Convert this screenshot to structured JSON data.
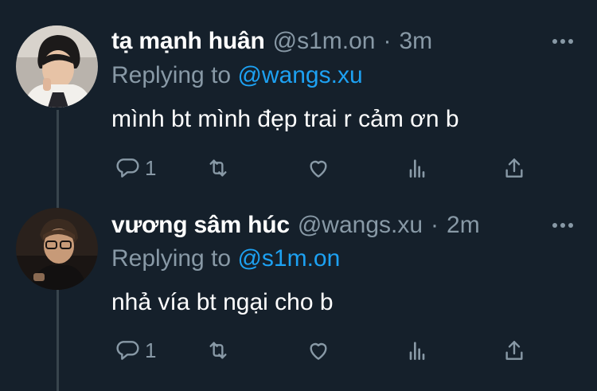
{
  "tweets": [
    {
      "name": "tạ mạnh huân",
      "handle": "@s1m.on",
      "separator": "·",
      "time": "3m",
      "replying_prefix": "Replying to",
      "replying_to": "@wangs.xu",
      "text": "mình bt mình đẹp trai r cảm ơn b",
      "reply_count": "1"
    },
    {
      "name": "vương sâm húc",
      "handle": "@wangs.xu",
      "separator": "·",
      "time": "2m",
      "replying_prefix": "Replying to",
      "replying_to": "@s1m.on",
      "text": "nhả vía bt ngại cho b",
      "reply_count": "1"
    }
  ],
  "colors": {
    "background": "#15202b",
    "text": "#ffffff",
    "muted": "#8899a6",
    "link": "#1da1f2",
    "thread_line": "#38444d"
  },
  "icons": [
    "reply-icon",
    "retweet-icon",
    "like-icon",
    "analytics-icon",
    "share-icon",
    "more-icon"
  ]
}
